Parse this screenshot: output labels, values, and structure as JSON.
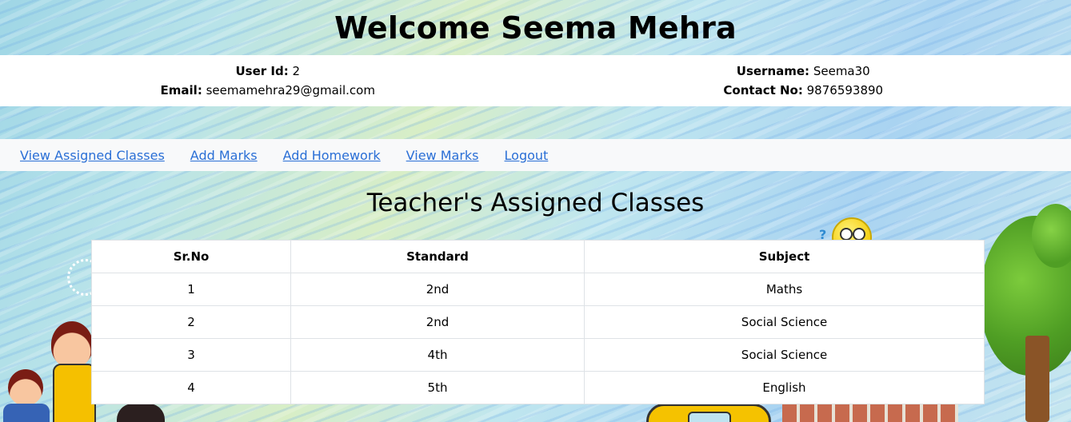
{
  "header": {
    "title": "Welcome Seema Mehra"
  },
  "user_info": {
    "user_id_label": "User Id:",
    "user_id": "2",
    "email_label": "Email:",
    "email": "seemamehra29@gmail.com",
    "username_label": "Username:",
    "username": "Seema30",
    "contact_label": "Contact No:",
    "contact": "9876593890"
  },
  "nav": {
    "items": [
      {
        "label": "View Assigned Classes"
      },
      {
        "label": "Add Marks"
      },
      {
        "label": "Add Homework"
      },
      {
        "label": "View Marks"
      },
      {
        "label": "Logout"
      }
    ]
  },
  "main": {
    "section_title": "Teacher's Assigned Classes",
    "table": {
      "columns": [
        "Sr.No",
        "Standard",
        "Subject"
      ],
      "rows": [
        [
          "1",
          "2nd",
          "Maths"
        ],
        [
          "2",
          "2nd",
          "Social Science"
        ],
        [
          "3",
          "4th",
          "Social Science"
        ],
        [
          "4",
          "5th",
          "English"
        ]
      ]
    }
  },
  "decor": {
    "qmark": "?"
  }
}
